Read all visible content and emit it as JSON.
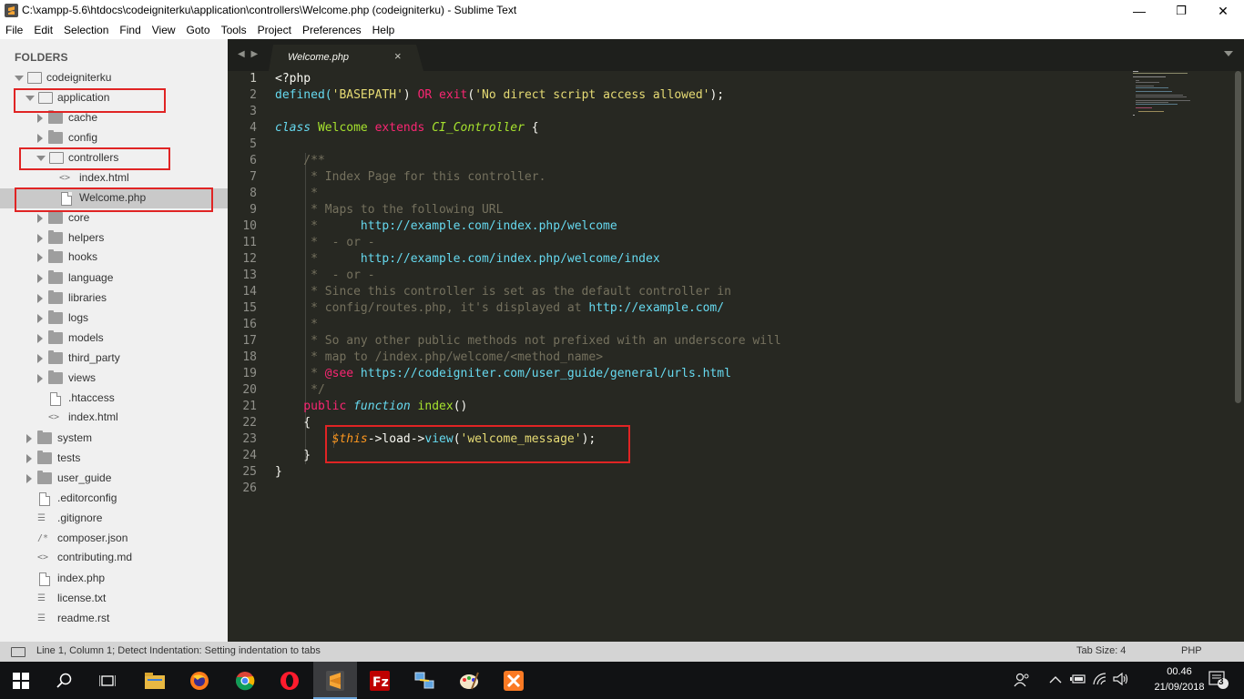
{
  "window": {
    "title": "C:\\xampp-5.6\\htdocs\\codeigniterku\\application\\controllers\\Welcome.php (codeigniterku) - Sublime Text",
    "minimize": "—",
    "maximize": "❐",
    "close": "✕"
  },
  "menu": [
    "File",
    "Edit",
    "Selection",
    "Find",
    "View",
    "Goto",
    "Tools",
    "Project",
    "Preferences",
    "Help"
  ],
  "sidebar": {
    "title": "FOLDERS",
    "items": [
      {
        "label": "codeigniterku",
        "icon": "folder-open-icon"
      },
      {
        "label": "application",
        "icon": "folder-open-icon"
      },
      {
        "label": "cache",
        "icon": "folder-icon"
      },
      {
        "label": "config",
        "icon": "folder-icon"
      },
      {
        "label": "controllers",
        "icon": "folder-open-icon"
      },
      {
        "label": "index.html",
        "icon": "code-file-icon"
      },
      {
        "label": "Welcome.php",
        "icon": "file-icon"
      },
      {
        "label": "core",
        "icon": "folder-icon"
      },
      {
        "label": "helpers",
        "icon": "folder-icon"
      },
      {
        "label": "hooks",
        "icon": "folder-icon"
      },
      {
        "label": "language",
        "icon": "folder-icon"
      },
      {
        "label": "libraries",
        "icon": "folder-icon"
      },
      {
        "label": "logs",
        "icon": "folder-icon"
      },
      {
        "label": "models",
        "icon": "folder-icon"
      },
      {
        "label": "third_party",
        "icon": "folder-icon"
      },
      {
        "label": "views",
        "icon": "folder-icon"
      },
      {
        "label": ".htaccess",
        "icon": "file-icon"
      },
      {
        "label": "index.html",
        "icon": "code-file-icon"
      },
      {
        "label": "system",
        "icon": "folder-icon"
      },
      {
        "label": "tests",
        "icon": "folder-icon"
      },
      {
        "label": "user_guide",
        "icon": "folder-icon"
      },
      {
        "label": ".editorconfig",
        "icon": "file-icon"
      },
      {
        "label": ".gitignore",
        "icon": "text-file-icon"
      },
      {
        "label": "composer.json",
        "icon": "comment-file-icon"
      },
      {
        "label": "contributing.md",
        "icon": "code-file-icon"
      },
      {
        "label": "index.php",
        "icon": "file-icon"
      },
      {
        "label": "license.txt",
        "icon": "text-file-icon"
      },
      {
        "label": "readme.rst",
        "icon": "text-file-icon"
      }
    ]
  },
  "tab": {
    "label": "Welcome.php",
    "close": "×",
    "nav": "◀ ▶"
  },
  "editor": {
    "line_numbers": [
      "1",
      "2",
      "3",
      "4",
      "5",
      "6",
      "7",
      "8",
      "9",
      "10",
      "11",
      "12",
      "13",
      "14",
      "15",
      "16",
      "17",
      "18",
      "19",
      "20",
      "21",
      "22",
      "23",
      "24",
      "25",
      "26"
    ],
    "code": {
      "l1": "<?php",
      "l2_a": "defined(",
      "l2_b": "'BASEPATH'",
      "l2_c": ") ",
      "l2_d": "OR",
      "l2_e": " ",
      "l2_f": "exit",
      "l2_g": "(",
      "l2_h": "'No direct script access allowed'",
      "l2_i": ");",
      "l4_a": "class",
      "l4_b": " Welcome ",
      "l4_c": "extends",
      "l4_d": " CI_Controller",
      "l4_e": " {",
      "l6": "    /**",
      "l7": "     * Index Page for this controller.",
      "l8": "     *",
      "l9": "     * Maps to the following URL",
      "l10_a": "     *      ",
      "l10_b": "http://example.com/index.php/welcome",
      "l11": "     *  - or -",
      "l12_a": "     *      ",
      "l12_b": "http://example.com/index.php/welcome/index",
      "l13": "     *  - or -",
      "l14": "     * Since this controller is set as the default controller in",
      "l15_a": "     * config/routes.php, it's displayed at ",
      "l15_b": "http://example.com/",
      "l16": "     *",
      "l17": "     * So any other public methods not prefixed with an underscore will",
      "l18": "     * map to /index.php/welcome/<method_name>",
      "l19_a": "     * ",
      "l19_b": "@see",
      "l19_c": " https://codeigniter.com/user_guide/general/urls.html",
      "l20": "     */",
      "l21_a": "    public",
      "l21_b": " function",
      "l21_c": " index",
      "l21_d": "()",
      "l22": "    {",
      "l23_a": "        ",
      "l23_b": "$this",
      "l23_c": "->load->",
      "l23_d": "view",
      "l23_e": "(",
      "l23_f": "'welcome_message'",
      "l23_g": ");",
      "l24": "    }",
      "l25": "}"
    }
  },
  "status": {
    "text": "Line 1, Column 1; Detect Indentation: Setting indentation to tabs",
    "tab_size": "Tab Size: 4",
    "syntax": "PHP"
  },
  "taskbar": {
    "time": "00.46",
    "date": "21/09/2018",
    "notifications": "3"
  },
  "colors": {
    "editor_bg": "#272822",
    "keyword": "#f92672",
    "string": "#e6db74",
    "function": "#66d9ef",
    "class": "#a6e22e",
    "comment": "#75715e",
    "variable": "#fd971f",
    "highlight_box": "#e02424"
  }
}
